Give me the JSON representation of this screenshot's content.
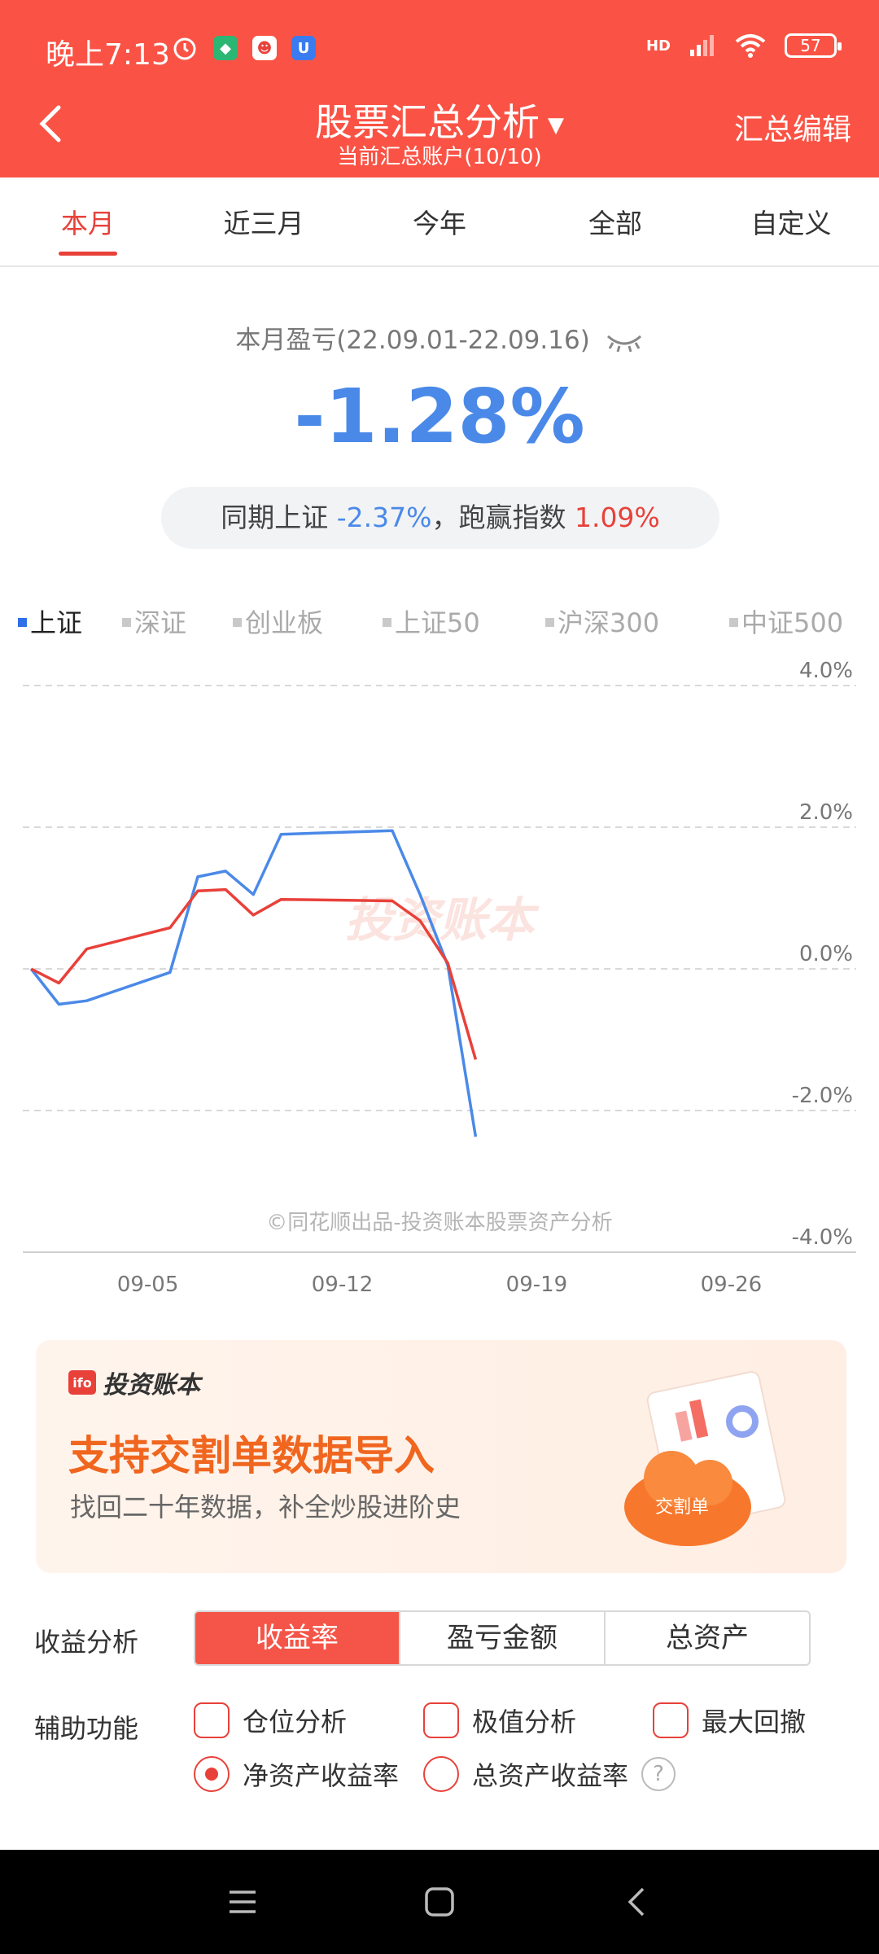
{
  "status_bar": {
    "time": "晚上7:13",
    "network_label": "HD",
    "battery": "57",
    "icons": [
      "alarm-icon",
      "app-green-icon",
      "app-red-icon",
      "app-blue-icon",
      "signal-icon",
      "wifi-icon",
      "battery-icon"
    ]
  },
  "navbar": {
    "title": "股票汇总分析",
    "subtitle": "当前汇总账户(10/10)",
    "right_action": "汇总编辑",
    "back_icon": "chevron-left-icon",
    "dropdown_icon": "triangle-down-icon"
  },
  "tabs": [
    {
      "label": "本月",
      "active": true
    },
    {
      "label": "近三月",
      "active": false
    },
    {
      "label": "今年",
      "active": false
    },
    {
      "label": "全部",
      "active": false
    },
    {
      "label": "自定义",
      "active": false
    }
  ],
  "summary": {
    "label": "本月盈亏(22.09.01-22.09.16)",
    "value": "-1.28%",
    "compare_prefix": "同期上证",
    "compare_index_value": "-2.37%",
    "compare_mid": "，跑赢指数",
    "compare_excess_value": "1.09%"
  },
  "legend": [
    {
      "label": "上证",
      "active": true
    },
    {
      "label": "深证",
      "active": false
    },
    {
      "label": "创业板",
      "active": false
    },
    {
      "label": "上证50",
      "active": false
    },
    {
      "label": "沪深300",
      "active": false
    },
    {
      "label": "中证500",
      "active": false
    }
  ],
  "chart_data": {
    "type": "line",
    "y_ticks": [
      "4.0%",
      "2.0%",
      "0.0%",
      "-2.0%",
      "-4.0%"
    ],
    "ylim": [
      -4.0,
      4.0
    ],
    "x_ticks": [
      {
        "label": "09-05",
        "day": 5
      },
      {
        "label": "09-12",
        "day": 12
      },
      {
        "label": "09-19",
        "day": 19
      },
      {
        "label": "09-26",
        "day": 26
      }
    ],
    "xlim_days": [
      0.5,
      30.5
    ],
    "watermark": "投资账本",
    "footnote": "©同花顺出品-投资账本股票资产分析",
    "series": [
      {
        "color": "#4a89e8",
        "points": [
          [
            0.8,
            0.0
          ],
          [
            1.8,
            -0.5
          ],
          [
            2.8,
            -0.45
          ],
          [
            5.8,
            -0.05
          ],
          [
            6.8,
            1.3
          ],
          [
            7.8,
            1.38
          ],
          [
            8.8,
            1.05
          ],
          [
            9.8,
            1.9
          ],
          [
            13.8,
            1.95
          ],
          [
            14.8,
            1.05
          ],
          [
            15.8,
            0.05
          ],
          [
            16.8,
            -2.37
          ]
        ]
      },
      {
        "color": "#e8413a",
        "points": [
          [
            0.8,
            0.0
          ],
          [
            1.8,
            -0.2
          ],
          [
            2.8,
            0.28
          ],
          [
            5.8,
            0.58
          ],
          [
            6.8,
            1.1
          ],
          [
            7.8,
            1.12
          ],
          [
            8.8,
            0.76
          ],
          [
            9.8,
            0.98
          ],
          [
            13.8,
            0.96
          ],
          [
            14.8,
            0.68
          ],
          [
            15.8,
            0.08
          ],
          [
            16.8,
            -1.28
          ]
        ]
      }
    ]
  },
  "banner": {
    "brand": "投资账本",
    "brand_logo": "ifo",
    "headline": "支持交割单数据导入",
    "description": "找回二十年数据，补全炒股进阶史",
    "art_label": "交割单"
  },
  "analysis": {
    "label": "收益分析",
    "options": [
      {
        "label": "收益率",
        "active": true
      },
      {
        "label": "盈亏金额",
        "active": false
      },
      {
        "label": "总资产",
        "active": false
      }
    ]
  },
  "aux": {
    "label": "辅助功能",
    "checkboxes": [
      "仓位分析",
      "极值分析",
      "最大回撤"
    ],
    "radios": [
      {
        "label": "净资产收益率",
        "checked": true
      },
      {
        "label": "总资产收益率",
        "checked": false
      }
    ],
    "help_glyph": "?"
  }
}
